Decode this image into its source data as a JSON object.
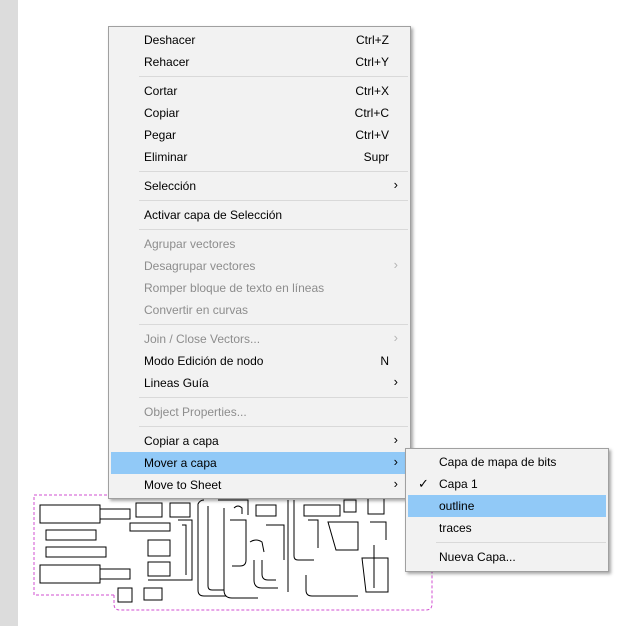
{
  "context_menu": {
    "items": [
      {
        "label": "Deshacer",
        "shortcut": "Ctrl+Z"
      },
      {
        "label": "Rehacer",
        "shortcut": "Ctrl+Y"
      },
      {
        "label": "Cortar",
        "shortcut": "Ctrl+X"
      },
      {
        "label": "Copiar",
        "shortcut": "Ctrl+C"
      },
      {
        "label": "Pegar",
        "shortcut": "Ctrl+V"
      },
      {
        "label": "Eliminar",
        "shortcut": "Supr"
      },
      {
        "label": "Selección"
      },
      {
        "label": "Activar capa de Selección"
      },
      {
        "label": "Agrupar vectores",
        "disabled": true
      },
      {
        "label": "Desagrupar vectores",
        "disabled": true
      },
      {
        "label": "Romper bloque de texto en líneas",
        "disabled": true
      },
      {
        "label": "Convertir en curvas",
        "disabled": true
      },
      {
        "label": "Join / Close Vectors...",
        "disabled": true
      },
      {
        "label": "Modo Edición de nodo",
        "shortcut": "N"
      },
      {
        "label": "Lineas Guía"
      },
      {
        "label": "Object Properties...",
        "disabled": true
      },
      {
        "label": "Copiar a capa"
      },
      {
        "label": "Mover a capa",
        "highlighted": true
      },
      {
        "label": "Move to Sheet"
      }
    ]
  },
  "submenu": {
    "items": [
      {
        "label": "Capa de mapa de bits"
      },
      {
        "label": "Capa 1",
        "checked": true
      },
      {
        "label": "outline",
        "highlighted": true
      },
      {
        "label": "traces"
      },
      {
        "label": "Nueva Capa..."
      }
    ]
  },
  "colors": {
    "highlight": "#91c9f7",
    "menu_background": "#f2f2f2",
    "outline_dashed": "#d14fd1"
  },
  "icons": {
    "submenu_arrow": "chevron-right-icon",
    "check": "check-icon"
  }
}
